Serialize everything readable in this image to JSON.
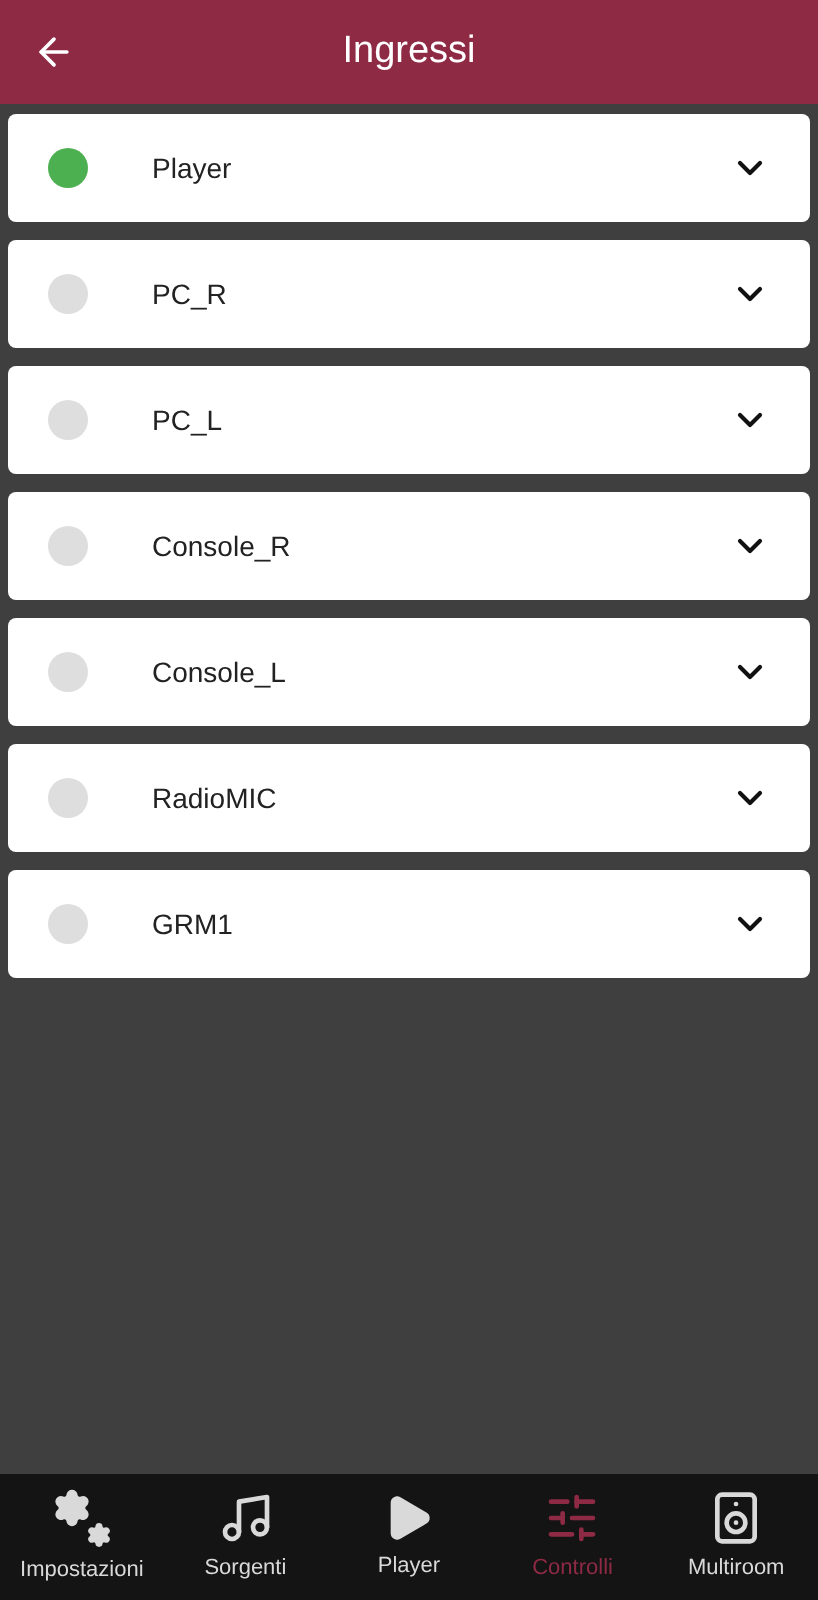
{
  "header": {
    "title": "Ingressi"
  },
  "inputs": [
    {
      "name": "Player",
      "active": true
    },
    {
      "name": "PC_R",
      "active": false
    },
    {
      "name": "PC_L",
      "active": false
    },
    {
      "name": "Console_R",
      "active": false
    },
    {
      "name": "Console_L",
      "active": false
    },
    {
      "name": "RadioMIC",
      "active": false
    },
    {
      "name": "GRM1",
      "active": false
    }
  ],
  "nav": [
    {
      "label": "Impostazioni",
      "kind": "settings",
      "selected": false
    },
    {
      "label": "Sorgenti",
      "kind": "music",
      "selected": false
    },
    {
      "label": "Player",
      "kind": "play",
      "selected": false
    },
    {
      "label": "Controlli",
      "kind": "sliders",
      "selected": true
    },
    {
      "label": "Multiroom",
      "kind": "speaker",
      "selected": false
    }
  ]
}
